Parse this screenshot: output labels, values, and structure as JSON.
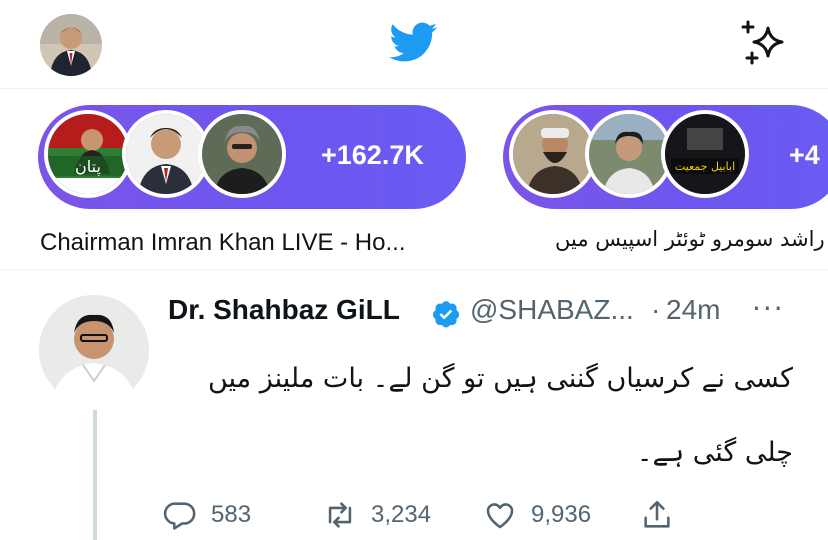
{
  "header": {
    "logo_icon": "twitter-bird-icon",
    "compose_icon": "sparkle-icon",
    "brand_color": "#1d9bf0"
  },
  "spaces": [
    {
      "count": "+162.7K",
      "title": "Chairman Imran Khan LIVE  - Ho..."
    },
    {
      "count": "+4",
      "title": "علامہ راشد سومرو ٹوئٹر اسپیس میں"
    }
  ],
  "tweet": {
    "name": "Dr. Shahbaz GiLL",
    "handle": "@SHABAZ...",
    "separator": "·",
    "time": "24m",
    "more": "···",
    "body": "کسی نے کرسیاں گننی ہیں تو گن لے۔ بات ملینز میں چلی گئی ہے۔",
    "actions": {
      "replies": "583",
      "retweets": "3,234",
      "likes": "9,936"
    }
  }
}
